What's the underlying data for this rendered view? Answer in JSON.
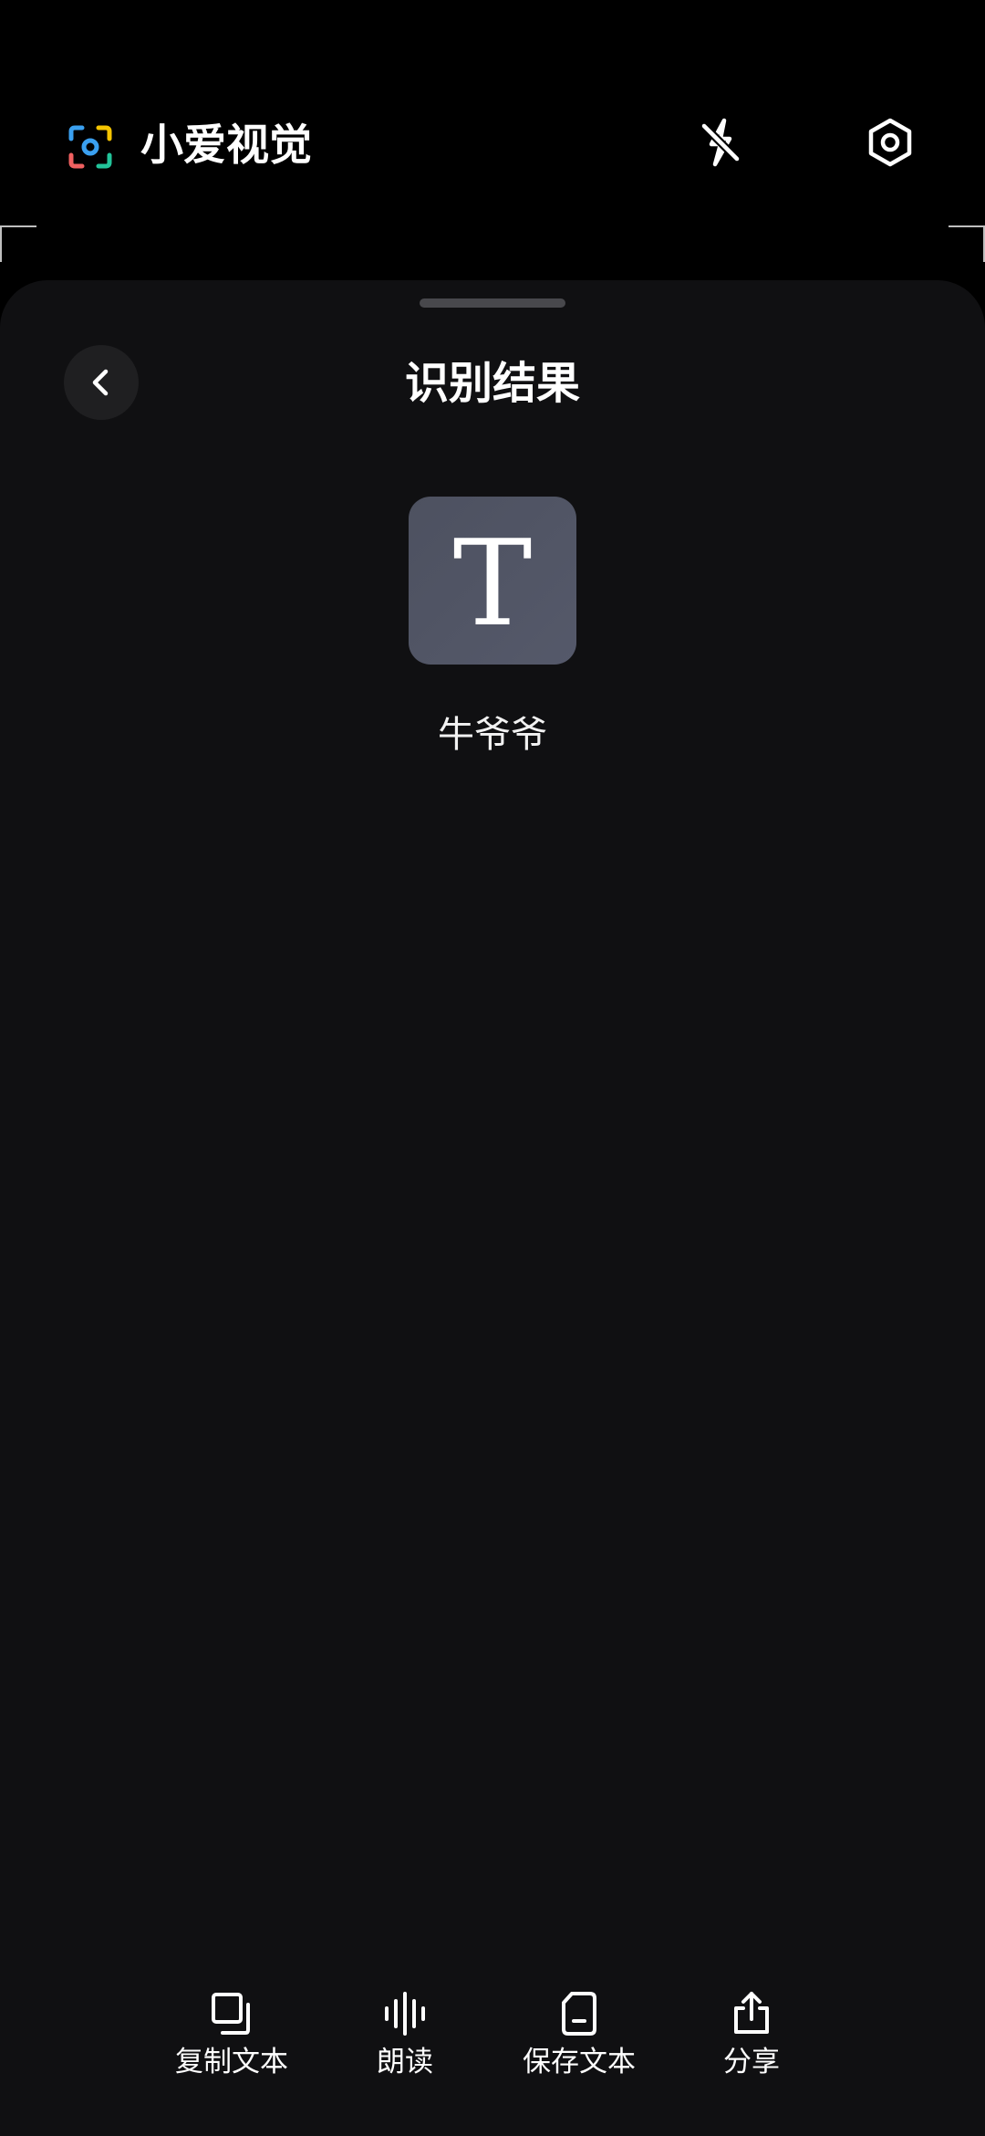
{
  "app_bar": {
    "title": "小爱视觉",
    "logo_icon": "camera-focus-icon",
    "flash_icon": "flash-off-icon",
    "settings_icon": "hexagon-settings-icon"
  },
  "sheet": {
    "title": "识别结果",
    "back_icon": "chevron-left-icon",
    "result_type_glyph": "T",
    "result_text": "牛爷爷"
  },
  "actions": [
    {
      "label": "复制文本",
      "icon": "copy-icon"
    },
    {
      "label": "朗读",
      "icon": "soundwave-icon"
    },
    {
      "label": "保存文本",
      "icon": "document-icon"
    },
    {
      "label": "分享",
      "icon": "share-icon"
    }
  ],
  "colors": {
    "background": "#000000",
    "sheet": "#101012",
    "icon_tile": "#4f5363",
    "logo_blue": "#3aa0f0",
    "logo_yellow": "#f5c400",
    "logo_red": "#f06060",
    "logo_green": "#22c49a"
  }
}
